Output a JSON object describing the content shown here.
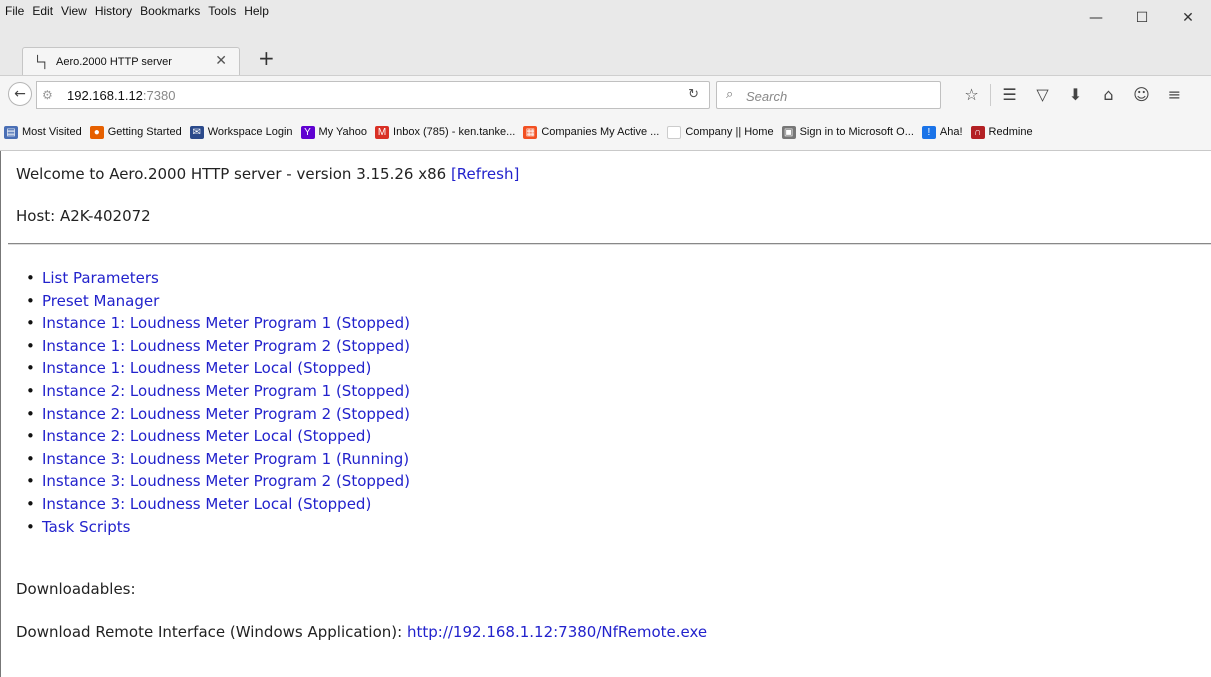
{
  "menubar": {
    "items": [
      "File",
      "Edit",
      "View",
      "History",
      "Bookmarks",
      "Tools",
      "Help"
    ]
  },
  "window_controls": {
    "minimize": "—",
    "maximize": "☐",
    "close": "✕"
  },
  "tab": {
    "title": "Aero.2000 HTTP server",
    "close": "✕",
    "new_tab": "+"
  },
  "navbar": {
    "url_host": "192.168.1.12",
    "url_port": ":7380",
    "search_placeholder": "Search",
    "back_icon": "left-arrow-icon",
    "reload_icon": "reload-icon",
    "icons": [
      "star-icon",
      "reading-list-icon",
      "pocket-icon",
      "download-icon",
      "home-icon",
      "hello-icon",
      "menu-icon"
    ]
  },
  "bookmarks": [
    {
      "label": "Most Visited",
      "icon": "most-visited-icon",
      "color": "#4a6fb5",
      "glyph": "▤"
    },
    {
      "label": "Getting Started",
      "icon": "firefox-icon",
      "color": "#e66000",
      "glyph": "●"
    },
    {
      "label": "Workspace Login",
      "icon": "mail-icon",
      "color": "#2b4a8b",
      "glyph": "✉"
    },
    {
      "label": "My Yahoo",
      "icon": "yahoo-icon",
      "color": "#5f01d1",
      "glyph": "Y"
    },
    {
      "label": "Inbox (785) - ken.tanke...",
      "icon": "gmail-icon",
      "color": "#d93025",
      "glyph": "M"
    },
    {
      "label": "Companies My Active ...",
      "icon": "windows-icon",
      "color": "#f25022",
      "glyph": "▦"
    },
    {
      "label": "Company || Home",
      "icon": "blank-page-icon",
      "color": "#ffffff",
      "glyph": ""
    },
    {
      "label": "Sign in to Microsoft O...",
      "icon": "microsoft-icon",
      "color": "#777777",
      "glyph": "▣"
    },
    {
      "label": "Aha!",
      "icon": "aha-icon",
      "color": "#1a73e8",
      "glyph": "!"
    },
    {
      "label": "Redmine",
      "icon": "redmine-icon",
      "color": "#b32024",
      "glyph": "∩"
    }
  ],
  "page": {
    "welcome_text": "Welcome to Aero.2000 HTTP server - version 3.15.26 x86 ",
    "refresh_link": "[Refresh]",
    "host": "Host: A2K-402072",
    "links": [
      "List Parameters",
      "Preset Manager",
      "Instance 1: Loudness Meter Program 1 (Stopped)",
      "Instance 1: Loudness Meter Program 2 (Stopped)",
      "Instance 1: Loudness Meter Local (Stopped)",
      "Instance 2: Loudness Meter Program 1 (Stopped)",
      "Instance 2: Loudness Meter Program 2 (Stopped)",
      "Instance 2: Loudness Meter Local (Stopped)",
      "Instance 3: Loudness Meter Program 1 (Running)",
      "Instance 3: Loudness Meter Program 2 (Stopped)",
      "Instance 3: Loudness Meter Local (Stopped)",
      "Task Scripts"
    ],
    "downloadables_label": "Downloadables:",
    "download_label": "Download Remote Interface (Windows Application): ",
    "download_link": "http://192.168.1.12:7380/NfRemote.exe"
  }
}
